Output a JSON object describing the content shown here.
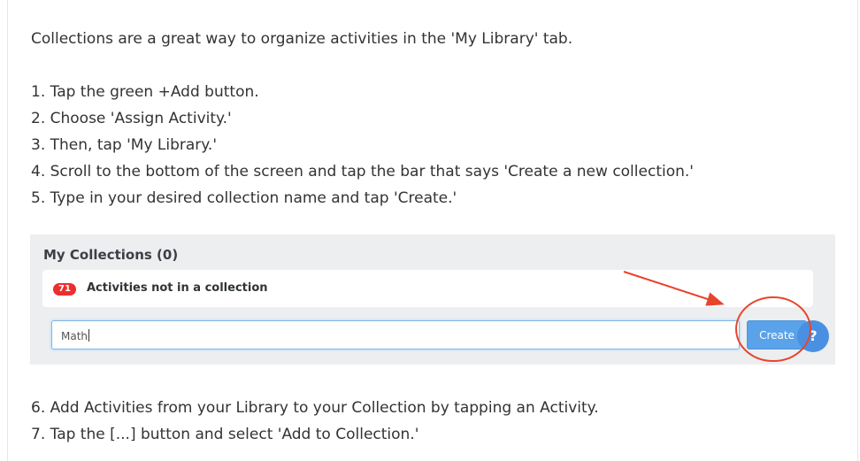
{
  "article": {
    "intro": "Collections are a great way to organize activities in the 'My Library' tab.",
    "steps_before": [
      "1. Tap the green +Add button.",
      "2. Choose 'Assign Activity.'",
      "3. Then, tap 'My Library.'",
      "4. Scroll to the bottom of the screen and tap the bar that says 'Create a new collection.'",
      "5. Type in your desired collection name and tap 'Create.'"
    ],
    "steps_after": [
      "6. Add Activities from your Library to your Collection by tapping an Activity.",
      "7. Tap the [...] button and select 'Add to Collection.'"
    ]
  },
  "screenshot": {
    "title": "My Collections (0)",
    "badge_count": "71",
    "uncollected_label": "Activities not in a collection",
    "collection_name_value": "Math",
    "create_label": "Create",
    "help_icon_glyph": "?",
    "annotation_color": "#e8442b"
  },
  "colors": {
    "badge": "#ea2f2f",
    "create_button": "#5aa2e9",
    "help_button": "#4a90e2",
    "panel_background": "#eceeef"
  }
}
